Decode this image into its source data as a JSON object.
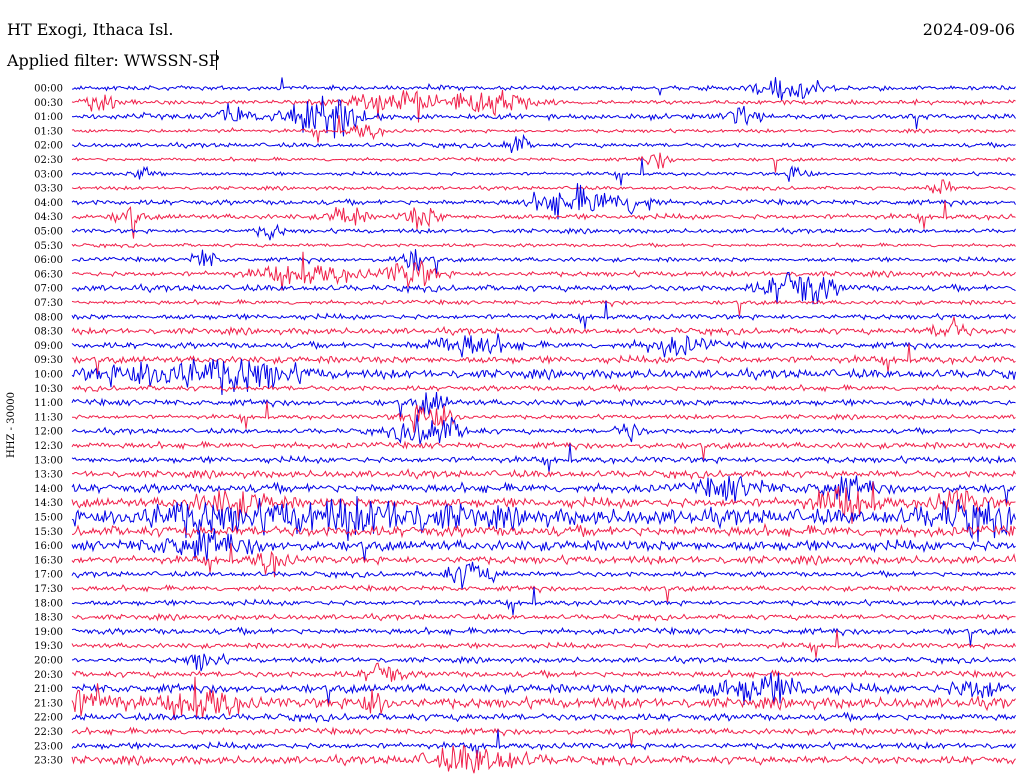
{
  "header": {
    "station": "HT Exogi, Ithaca Isl.",
    "date": "2024-09-06",
    "filter": "Applied filter: WWSSN-SP"
  },
  "chart_data": {
    "type": "line",
    "title": "HT Exogi, Ithaca Isl.",
    "ylabel": "HHZ - 30000",
    "xlabel": "",
    "time_labels": [
      "00:00",
      "00:30",
      "01:00",
      "01:30",
      "02:00",
      "02:30",
      "03:00",
      "03:30",
      "04:00",
      "04:30",
      "05:00",
      "05:30",
      "06:00",
      "06:30",
      "07:00",
      "07:30",
      "08:00",
      "08:30",
      "09:00",
      "09:30",
      "10:00",
      "10:30",
      "11:00",
      "11:30",
      "12:00",
      "12:30",
      "13:00",
      "13:30",
      "14:00",
      "14:30",
      "15:00",
      "15:30",
      "16:00",
      "16:30",
      "17:00",
      "17:30",
      "18:00",
      "18:30",
      "19:00",
      "19:30",
      "20:00",
      "20:30",
      "21:00",
      "21:30",
      "22:00",
      "22:30",
      "23:00",
      "23:30"
    ],
    "trace_colors": [
      "#0000e6",
      "#f0204a"
    ],
    "grid": false,
    "legend": "none",
    "noise_level": [
      0.25,
      0.25,
      0.3,
      0.2,
      0.25,
      0.2,
      0.2,
      0.2,
      0.3,
      0.3,
      0.25,
      0.2,
      0.25,
      0.3,
      0.35,
      0.25,
      0.3,
      0.35,
      0.35,
      0.4,
      0.5,
      0.3,
      0.35,
      0.25,
      0.3,
      0.35,
      0.35,
      0.4,
      0.5,
      0.55,
      0.9,
      0.6,
      0.6,
      0.45,
      0.3,
      0.3,
      0.3,
      0.3,
      0.35,
      0.3,
      0.3,
      0.35,
      0.5,
      0.6,
      0.4,
      0.35,
      0.35,
      0.45
    ],
    "events": [
      {
        "row": 0,
        "t": 0.76,
        "amp": 1.6,
        "width": 0.04
      },
      {
        "row": 1,
        "t": 0.03,
        "amp": 1.2,
        "width": 0.02
      },
      {
        "row": 1,
        "t": 0.34,
        "amp": 1.5,
        "width": 0.05
      },
      {
        "row": 1,
        "t": 0.44,
        "amp": 1.6,
        "width": 0.05
      },
      {
        "row": 2,
        "t": 0.27,
        "amp": 2.6,
        "width": 0.05
      },
      {
        "row": 2,
        "t": 0.17,
        "amp": 1.2,
        "width": 0.02
      },
      {
        "row": 2,
        "t": 0.71,
        "amp": 1.0,
        "width": 0.02
      },
      {
        "row": 3,
        "t": 0.31,
        "amp": 1.0,
        "width": 0.02
      },
      {
        "row": 4,
        "t": 0.47,
        "amp": 1.3,
        "width": 0.015
      },
      {
        "row": 5,
        "t": 0.62,
        "amp": 1.1,
        "width": 0.015
      },
      {
        "row": 6,
        "t": 0.08,
        "amp": 1.0,
        "width": 0.015
      },
      {
        "row": 6,
        "t": 0.77,
        "amp": 1.2,
        "width": 0.015
      },
      {
        "row": 7,
        "t": 0.92,
        "amp": 1.2,
        "width": 0.015
      },
      {
        "row": 8,
        "t": 0.51,
        "amp": 1.2,
        "width": 0.03
      },
      {
        "row": 8,
        "t": 0.55,
        "amp": 1.4,
        "width": 0.04
      },
      {
        "row": 8,
        "t": 0.6,
        "amp": 1.4,
        "width": 0.02
      },
      {
        "row": 9,
        "t": 0.06,
        "amp": 1.4,
        "width": 0.015
      },
      {
        "row": 9,
        "t": 0.29,
        "amp": 1.5,
        "width": 0.02
      },
      {
        "row": 9,
        "t": 0.37,
        "amp": 1.4,
        "width": 0.02
      },
      {
        "row": 10,
        "t": 0.21,
        "amp": 1.0,
        "width": 0.015
      },
      {
        "row": 12,
        "t": 0.14,
        "amp": 1.3,
        "width": 0.015
      },
      {
        "row": 12,
        "t": 0.36,
        "amp": 1.4,
        "width": 0.02
      },
      {
        "row": 13,
        "t": 0.25,
        "amp": 1.2,
        "width": 0.06
      },
      {
        "row": 13,
        "t": 0.36,
        "amp": 1.8,
        "width": 0.03
      },
      {
        "row": 14,
        "t": 0.77,
        "amp": 2.4,
        "width": 0.04
      },
      {
        "row": 17,
        "t": 0.93,
        "amp": 1.5,
        "width": 0.02
      },
      {
        "row": 18,
        "t": 0.64,
        "amp": 1.2,
        "width": 0.04
      },
      {
        "row": 18,
        "t": 0.42,
        "amp": 1.3,
        "width": 0.05
      },
      {
        "row": 20,
        "t": 0.1,
        "amp": 1.8,
        "width": 0.08
      },
      {
        "row": 20,
        "t": 0.19,
        "amp": 1.6,
        "width": 0.06
      },
      {
        "row": 22,
        "t": 0.38,
        "amp": 1.4,
        "width": 0.02
      },
      {
        "row": 23,
        "t": 0.38,
        "amp": 2.2,
        "width": 0.03
      },
      {
        "row": 24,
        "t": 0.38,
        "amp": 2.0,
        "width": 0.04
      },
      {
        "row": 24,
        "t": 0.59,
        "amp": 1.2,
        "width": 0.015
      },
      {
        "row": 28,
        "t": 0.7,
        "amp": 1.3,
        "width": 0.04
      },
      {
        "row": 28,
        "t": 0.82,
        "amp": 1.1,
        "width": 0.04
      },
      {
        "row": 29,
        "t": 0.17,
        "amp": 1.4,
        "width": 0.05
      },
      {
        "row": 29,
        "t": 0.82,
        "amp": 1.6,
        "width": 0.04
      },
      {
        "row": 29,
        "t": 0.94,
        "amp": 1.3,
        "width": 0.03
      },
      {
        "row": 30,
        "t": 0.3,
        "amp": 1.6,
        "width": 0.15
      },
      {
        "row": 30,
        "t": 0.12,
        "amp": 1.3,
        "width": 0.07
      },
      {
        "row": 30,
        "t": 0.95,
        "amp": 1.4,
        "width": 0.06
      },
      {
        "row": 32,
        "t": 0.14,
        "amp": 1.4,
        "width": 0.06
      },
      {
        "row": 33,
        "t": 0.21,
        "amp": 1.4,
        "width": 0.02
      },
      {
        "row": 34,
        "t": 0.42,
        "amp": 1.5,
        "width": 0.03
      },
      {
        "row": 40,
        "t": 0.14,
        "amp": 1.3,
        "width": 0.02
      },
      {
        "row": 41,
        "t": 0.33,
        "amp": 1.6,
        "width": 0.02
      },
      {
        "row": 42,
        "t": 0.73,
        "amp": 1.6,
        "width": 0.06
      },
      {
        "row": 42,
        "t": 0.96,
        "amp": 1.4,
        "width": 0.03
      },
      {
        "row": 43,
        "t": 0.02,
        "amp": 1.6,
        "width": 0.04
      },
      {
        "row": 43,
        "t": 0.14,
        "amp": 1.8,
        "width": 0.04
      },
      {
        "row": 43,
        "t": 0.32,
        "amp": 1.6,
        "width": 0.02
      },
      {
        "row": 47,
        "t": 0.43,
        "amp": 1.6,
        "width": 0.06
      }
    ]
  }
}
